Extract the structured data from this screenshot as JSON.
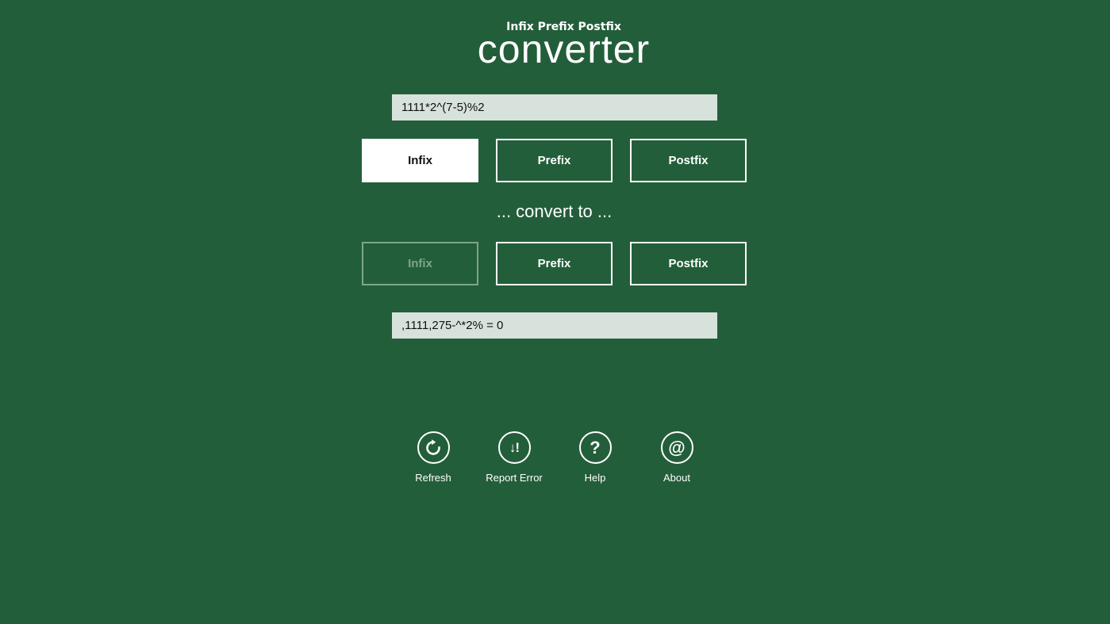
{
  "header": {
    "subtitle": "Infix Prefix Postfix",
    "title": "converter"
  },
  "input": {
    "value": "1111*2^(7-5)%2"
  },
  "from_modes": {
    "infix": "Infix",
    "prefix": "Prefix",
    "postfix": "Postfix",
    "selected": "Infix"
  },
  "convert_to_label": "... convert to ...",
  "to_modes": {
    "infix": "Infix",
    "prefix": "Prefix",
    "postfix": "Postfix",
    "disabled": "Infix"
  },
  "output": {
    "value": ",1111,275-^*2% = 0"
  },
  "actions": {
    "refresh": {
      "label": "Refresh",
      "icon": "refresh-icon"
    },
    "report_error": {
      "label": "Report Error",
      "icon": "report-error-icon",
      "glyph": "↓!"
    },
    "help": {
      "label": "Help",
      "icon": "help-icon",
      "glyph": "?"
    },
    "about": {
      "label": "About",
      "icon": "at-icon",
      "glyph": "@"
    }
  },
  "colors": {
    "background": "#235e3a",
    "field": "#d8e2dc",
    "disabled": "#7da58c"
  }
}
